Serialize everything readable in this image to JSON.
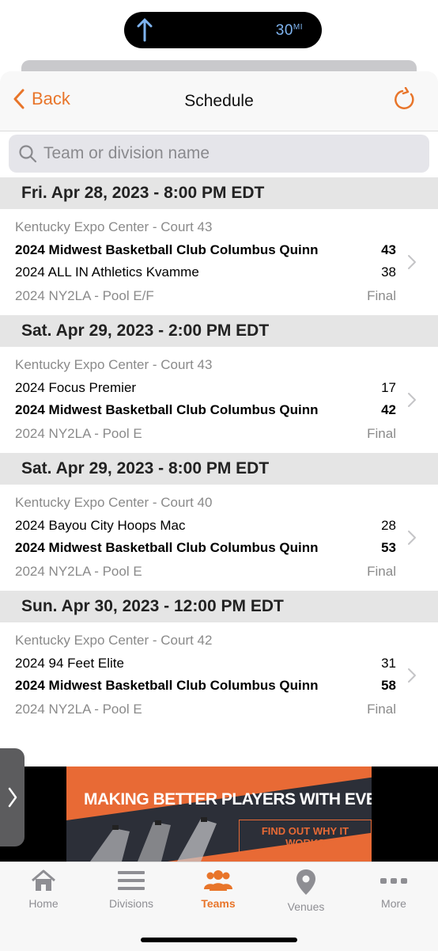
{
  "status_bar": {
    "nav_distance": "30",
    "nav_unit": "MI"
  },
  "header": {
    "back_label": "Back",
    "title": "Schedule"
  },
  "search": {
    "placeholder": "Team or division name"
  },
  "games": [
    {
      "date_header": "Fri. Apr 28, 2023 - 8:00 PM EDT",
      "venue": "Kentucky Expo Center - Court 43",
      "team1": "2024 Midwest Basketball Club Columbus Quinn",
      "score1": "43",
      "team1_winner": true,
      "team2": "2024 ALL IN Athletics Kvamme",
      "score2": "38",
      "team2_winner": false,
      "pool": "2024 NY2LA - Pool E/F",
      "status": "Final"
    },
    {
      "date_header": "Sat. Apr 29, 2023 - 2:00 PM EDT",
      "venue": "Kentucky Expo Center - Court 43",
      "team1": "2024 Focus Premier",
      "score1": "17",
      "team1_winner": false,
      "team2": "2024 Midwest Basketball Club Columbus Quinn",
      "score2": "42",
      "team2_winner": true,
      "pool": "2024 NY2LA - Pool E",
      "status": "Final"
    },
    {
      "date_header": "Sat. Apr 29, 2023 - 8:00 PM EDT",
      "venue": "Kentucky Expo Center - Court 40",
      "team1": "2024 Bayou City Hoops Mac",
      "score1": "28",
      "team1_winner": false,
      "team2": "2024 Midwest Basketball Club Columbus Quinn",
      "score2": "53",
      "team2_winner": true,
      "pool": "2024 NY2LA - Pool E",
      "status": "Final"
    },
    {
      "date_header": "Sun. Apr 30, 2023 - 12:00 PM EDT",
      "venue": "Kentucky Expo Center - Court 42",
      "team1": "2024 94 Feet Elite",
      "score1": "31",
      "team1_winner": false,
      "team2": "2024 Midwest Basketball Club Columbus Quinn",
      "score2": "58",
      "team2_winner": true,
      "pool": "2024 NY2LA - Pool E",
      "status": "Final"
    }
  ],
  "ad": {
    "headline": "MAKING BETTER PLAYERS WITH EVERY SHOT",
    "cta": "FIND OUT WHY IT WORKS"
  },
  "tabbar": {
    "items": [
      {
        "label": "Home",
        "icon": "home-icon"
      },
      {
        "label": "Divisions",
        "icon": "list-icon"
      },
      {
        "label": "Teams",
        "icon": "people-icon"
      },
      {
        "label": "Venues",
        "icon": "map-pin-icon"
      },
      {
        "label": "More",
        "icon": "more-icon"
      }
    ],
    "active": "Teams"
  },
  "colors": {
    "accent": "#e8752a",
    "header_bg": "#e5e5e5",
    "muted_text": "#8a8a8a",
    "ad_orange": "#e86a35"
  }
}
